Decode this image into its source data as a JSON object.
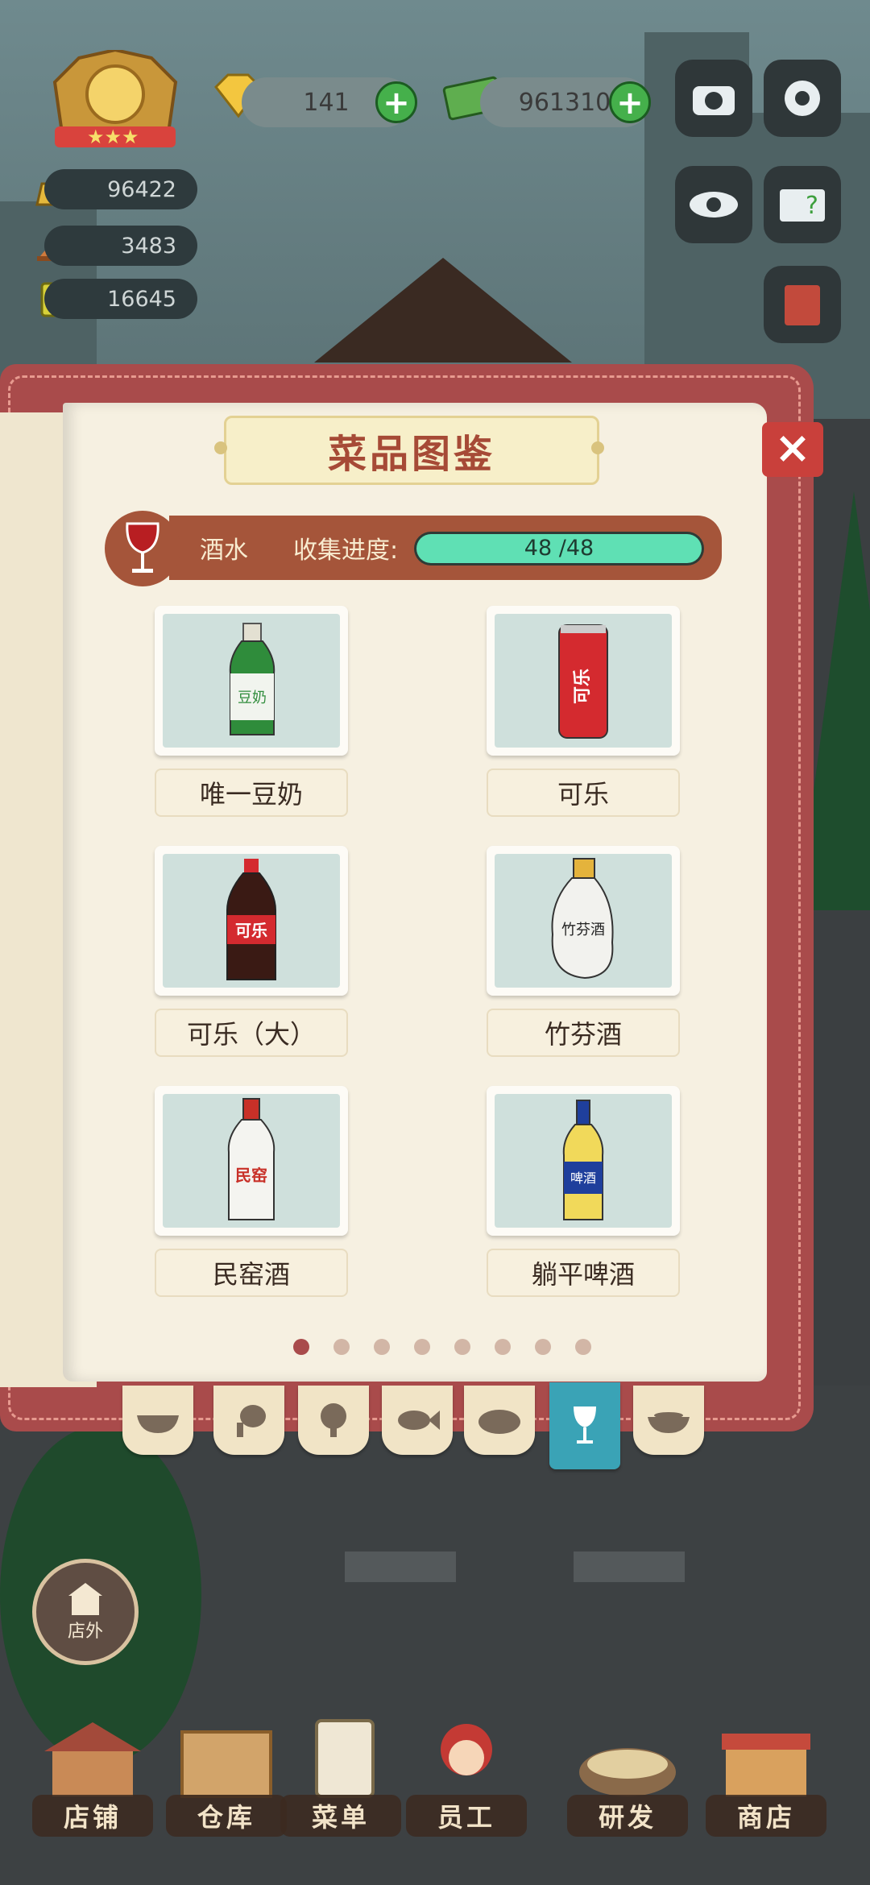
{
  "hud": {
    "gems": "141",
    "cash": "961310",
    "resources": [
      {
        "icon": "gold-ingot-icon",
        "value": "96422"
      },
      {
        "icon": "serving-tray-icon",
        "value": "3483"
      },
      {
        "icon": "ticket-icon",
        "value": "16645"
      }
    ]
  },
  "catalog": {
    "title": "菜品图鉴",
    "category": "酒水",
    "progress_label": "收集进度:",
    "progress_text": "48 /48",
    "progress_fraction": 1.0,
    "items": [
      {
        "name": "唯一豆奶",
        "icon": "soy-milk-bottle-icon"
      },
      {
        "name": "可乐",
        "icon": "cola-can-icon"
      },
      {
        "name": "可乐（大）",
        "icon": "cola-bottle-icon"
      },
      {
        "name": "竹芬酒",
        "icon": "bamboo-liquor-bottle-icon"
      },
      {
        "name": "民窑酒",
        "icon": "baijiu-bottle-icon"
      },
      {
        "name": "躺平啤酒",
        "icon": "beer-bottle-icon"
      }
    ],
    "page_count": 8,
    "current_page": 1
  },
  "bottle_text": {
    "soy": "豆奶",
    "can": "可乐",
    "big": "可乐",
    "bamboo": "竹芬酒",
    "min": "民窑",
    "beer": "啤酒"
  },
  "tabs": [
    "wok-icon",
    "drumstick-icon",
    "broccoli-icon",
    "fish-icon",
    "bread-icon",
    "wine-glass-icon",
    "soup-bowl-icon"
  ],
  "outside_button": "店外",
  "nav": [
    "店铺",
    "仓库",
    "菜单",
    "员工",
    "研发",
    "商店"
  ],
  "colors": {
    "accent": "#a94b4b",
    "progress": "#5fe0b4",
    "active_tab": "#3aa3b6"
  }
}
